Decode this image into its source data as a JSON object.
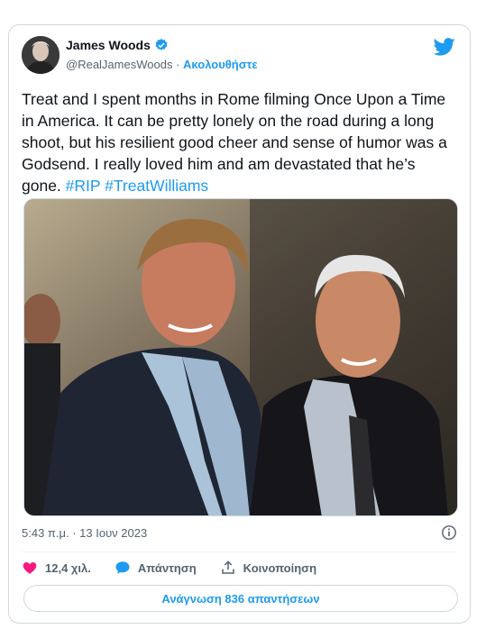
{
  "author": {
    "name": "James Woods",
    "handle": "@RealJamesWoods",
    "separator": "·",
    "follow_label": "Ακολουθήστε"
  },
  "tweet": {
    "text": "Treat and I spent months in Rome filming Once Upon a Time in America. It can be pretty lonely on the road during a long shoot, but his resilient good cheer and sense of humor was a Godsend. I really loved him and am devastated that he’s gone. ",
    "hashtags": [
      "#RIP",
      "#TreatWilliams"
    ],
    "timestamp": "5:43 π.μ. · 13 Ιουν 2023"
  },
  "actions": {
    "likes": "12,4 χιλ.",
    "reply_label": "Απάντηση",
    "share_label": "Κοινοποίηση"
  },
  "read_replies_label": "Ανάγνωση 836 απαντήσεων",
  "colors": {
    "accent": "#1d9bf0",
    "like": "#f91880",
    "muted": "#536471",
    "border": "#cfd9de"
  },
  "icons": [
    "verified-badge-icon",
    "twitter-bird-icon",
    "info-icon",
    "heart-icon",
    "reply-bubble-icon",
    "share-icon"
  ]
}
